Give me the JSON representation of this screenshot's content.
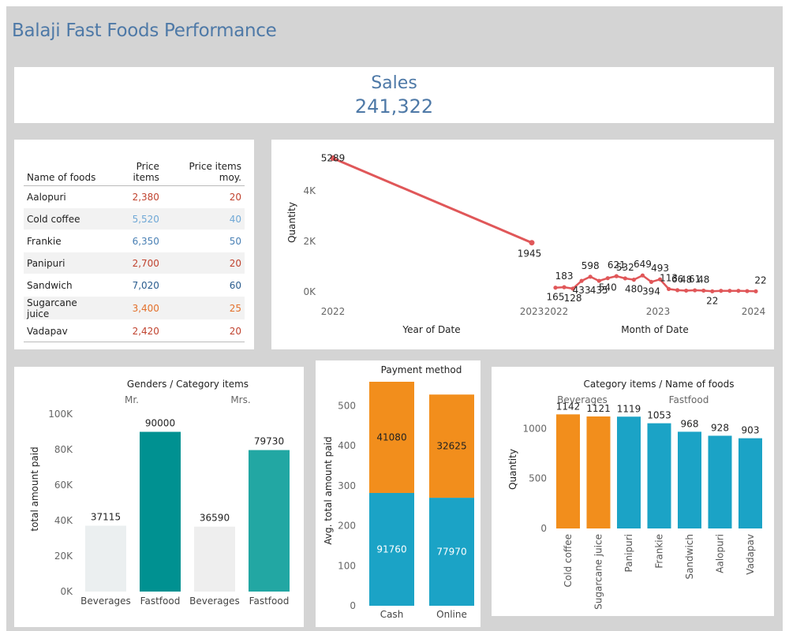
{
  "dashboard": {
    "title": "Balaji Fast Foods Performance"
  },
  "kpi": {
    "label": "Sales",
    "value": "241,322"
  },
  "colors": {
    "accent": "#4e79a7",
    "line": "#e05759",
    "orange": "#f28e1c",
    "cyan": "#1ba3c6",
    "teal_dark": "#009191",
    "teal_light": "#22a7a3",
    "grey_bar": "#ebeff0"
  },
  "food_table": {
    "headers": [
      "Name of foods",
      "Price items",
      "Price items moy."
    ],
    "rows": [
      {
        "name": "Aalopuri",
        "price": "2,380",
        "avg": "20",
        "color": "#c0432f"
      },
      {
        "name": "Cold coffee",
        "price": "5,520",
        "avg": "40",
        "color": "#6fa8d6"
      },
      {
        "name": "Frankie",
        "price": "6,350",
        "avg": "50",
        "color": "#4a80b4"
      },
      {
        "name": "Panipuri",
        "price": "2,700",
        "avg": "20",
        "color": "#c0432f"
      },
      {
        "name": "Sandwich",
        "price": "7,020",
        "avg": "60",
        "color": "#2a5c8e"
      },
      {
        "name": "Sugarcane juice",
        "price": "3,400",
        "avg": "25",
        "color": "#e3702b"
      },
      {
        "name": "Vadapav",
        "price": "2,420",
        "avg": "20",
        "color": "#c0432f"
      }
    ]
  },
  "chart_data": [
    {
      "id": "quantity_line",
      "type": "line",
      "ylabel": "Quantity",
      "yticks": [
        "0K",
        "2K",
        "4K"
      ],
      "ylim": [
        0,
        5400
      ],
      "panels": [
        {
          "xlabel": "Year of Date",
          "x": [
            "2022",
            "2023"
          ],
          "y": [
            5289,
            1945
          ],
          "point_labels": [
            "5289",
            "1945"
          ],
          "tick_labels": [
            "2022",
            "2023"
          ]
        },
        {
          "xlabel": "Month of Date",
          "x": [
            "2022-04",
            "2022-05",
            "2022-06",
            "2022-07",
            "2022-08",
            "2022-09",
            "2022-10",
            "2022-11",
            "2022-12",
            "2023-01",
            "2023-02",
            "2023-03",
            "2023-04",
            "2023-05",
            "2023-06",
            "2023-07",
            "2023-08",
            "2023-09",
            "2023-10",
            "2023-11",
            "2023-12",
            "2024-01",
            "2024-02",
            "2024-03"
          ],
          "y": [
            165,
            183,
            128,
            433,
            598,
            435,
            540,
            621,
            532,
            480,
            649,
            394,
            493,
            113,
            66,
            48,
            61,
            48,
            22,
            40,
            40,
            40,
            30,
            22
          ],
          "point_labels": [
            "165",
            "183",
            "128",
            "433",
            "598",
            "435",
            "540",
            "621",
            "532",
            "480",
            "649",
            "394",
            "493",
            "113",
            "66",
            "48",
            "61",
            "48",
            "22",
            "",
            "",
            "",
            "",
            ""
          ],
          "tick_labels": [
            "2022",
            "2023",
            "2024"
          ]
        }
      ]
    },
    {
      "id": "gender_category",
      "type": "bar",
      "title": "Genders  /  Category items",
      "ylabel": "total amount paid",
      "yticks": [
        "0K",
        "20K",
        "40K",
        "60K",
        "80K",
        "100K"
      ],
      "ylim": [
        0,
        100000
      ],
      "groups": [
        "Mr.",
        "Mrs."
      ],
      "categories": [
        "Beverages",
        "Fastfood",
        "Beverages",
        "Fastfood"
      ],
      "values": [
        37115,
        90000,
        36590,
        79730
      ],
      "labels": [
        "37115",
        "90000",
        "36590",
        "79730"
      ]
    },
    {
      "id": "payment_method",
      "type": "bar",
      "stacked": true,
      "title": "Payment method",
      "ylabel": "Avg. total amount paid",
      "yticks": [
        "0",
        "100",
        "200",
        "300",
        "400",
        "500"
      ],
      "ylim": [
        0,
        560
      ],
      "categories": [
        "Cash",
        "Online"
      ],
      "series": [
        {
          "values": [
            282,
            270
          ],
          "labels": [
            "91760",
            "77970"
          ],
          "color": "#1ba3c6"
        },
        {
          "values": [
            278,
            258
          ],
          "labels": [
            "41080",
            "32625"
          ],
          "color": "#f28e1c"
        }
      ]
    },
    {
      "id": "category_foods",
      "type": "bar",
      "title": "Category items  /  Name of foods",
      "ylabel": "Quantity",
      "yticks": [
        "0",
        "500",
        "1000"
      ],
      "ylim": [
        0,
        1200
      ],
      "groups": [
        "Beverages",
        "Fastfood"
      ],
      "categories": [
        "Cold coffee",
        "Sugarcane juice",
        "Panipuri",
        "Frankie",
        "Sandwich",
        "Aalopuri",
        "Vadapav"
      ],
      "values": [
        1142,
        1121,
        1119,
        1053,
        968,
        928,
        903
      ],
      "labels": [
        "1142",
        "1121",
        "1119",
        "1053",
        "968",
        "928",
        "903"
      ]
    }
  ]
}
